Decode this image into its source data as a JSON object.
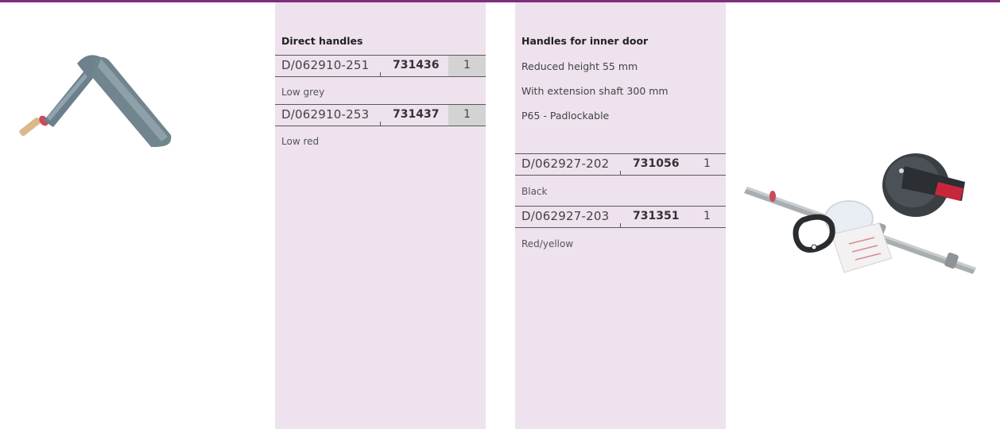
{
  "left_panel": {
    "heading": "Direct handles",
    "items": [
      {
        "reference": "D/062910-251",
        "code": "731436",
        "quantity": "1",
        "description": "Low grey"
      },
      {
        "reference": "D/062910-253",
        "code": "731437",
        "quantity": "1",
        "description": "Low red"
      }
    ]
  },
  "right_panel": {
    "heading": "Handles for inner door",
    "lines": [
      "Reduced height 55 mm",
      "With extension shaft 300 mm",
      "P65 - Padlockable"
    ],
    "items": [
      {
        "reference": "D/062927-202",
        "code": "731056",
        "quantity": "1",
        "description": "Black"
      },
      {
        "reference": "D/062927-203",
        "code": "731351",
        "quantity": "1",
        "description": "Red/yellow"
      }
    ]
  },
  "colors": {
    "accent_rule": "#7d2f7d",
    "panel_background": "#ede2ee",
    "quantity_cell": "#d3d3d3"
  }
}
